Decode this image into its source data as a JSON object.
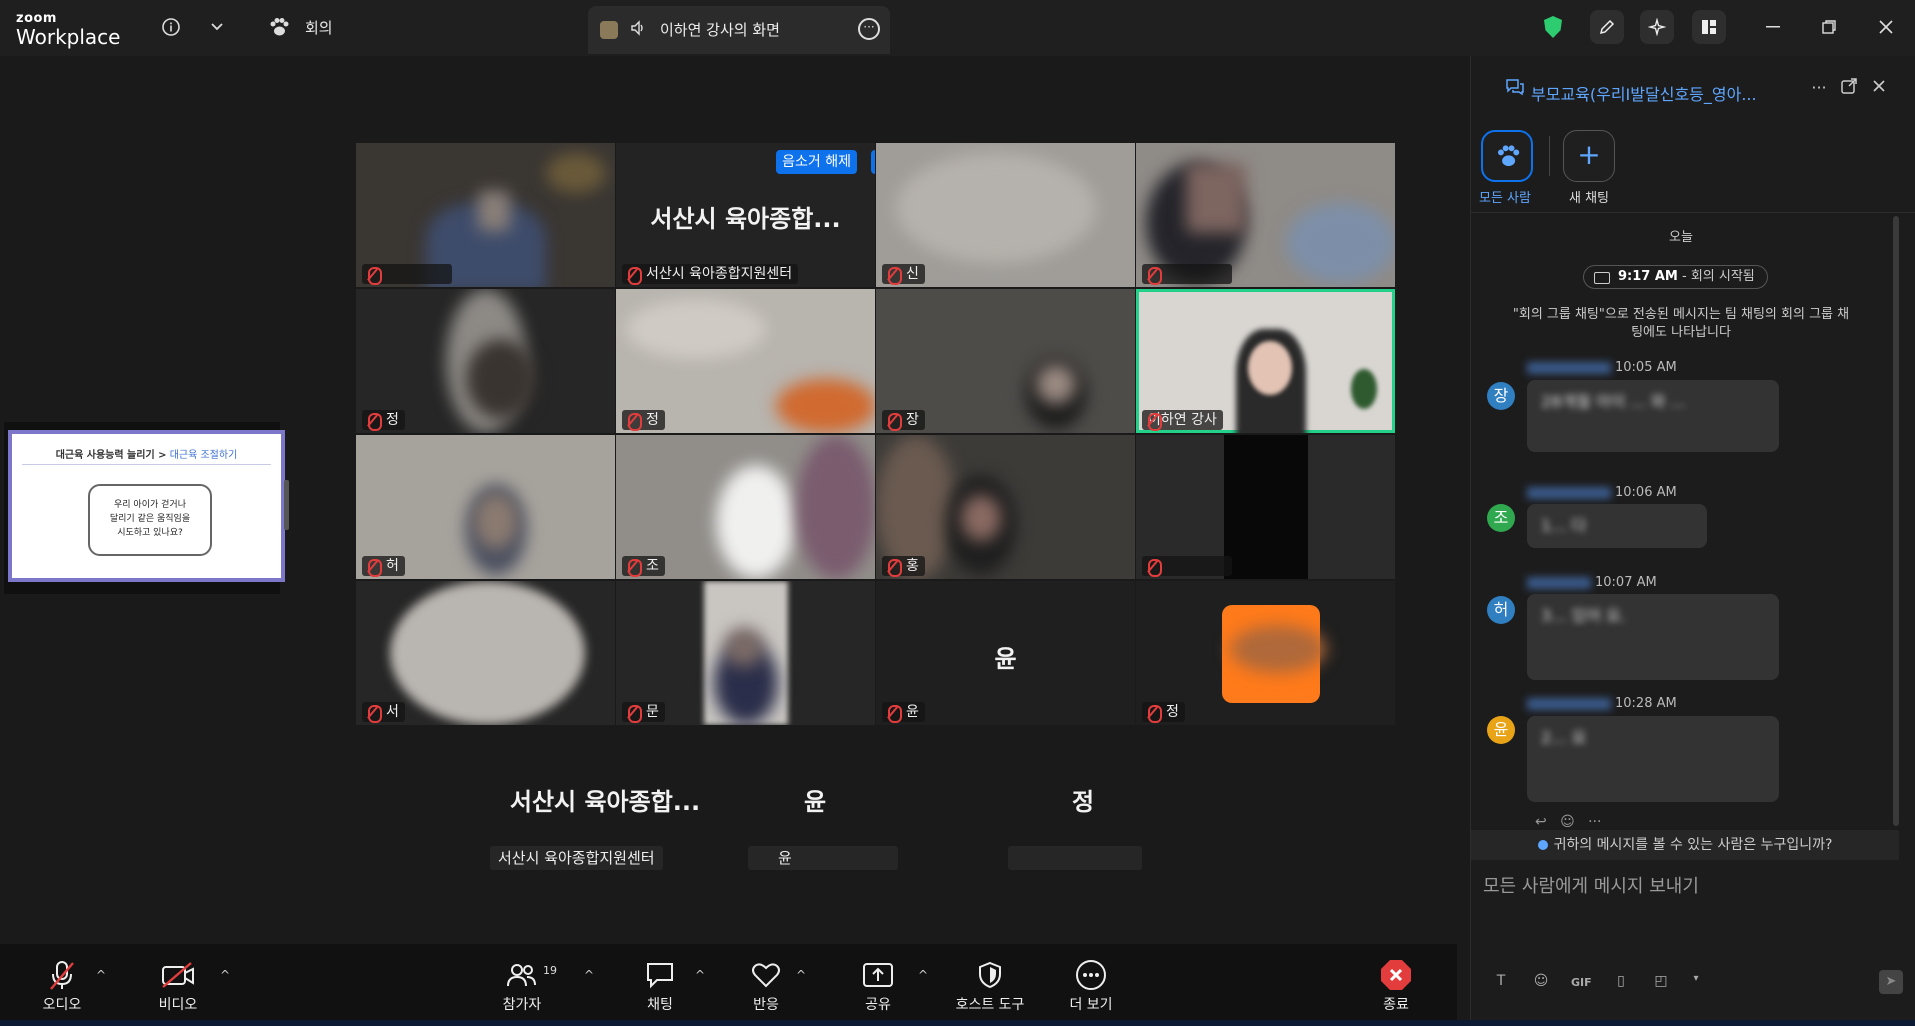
{
  "app": {
    "logo_top": "zoom",
    "logo_bottom": "Workplace",
    "meeting_menu_label": "회의",
    "share_title": "이하연 강사의 화면"
  },
  "grid": {
    "unmute_label": "음소거 해제",
    "tiles": [
      {
        "name": "",
        "big": ""
      },
      {
        "name": "서산시 육아종합지원센터",
        "big": "서산시 육아종합..."
      },
      {
        "name": "신",
        "big": ""
      },
      {
        "name": "",
        "big": ""
      },
      {
        "name": "정",
        "big": ""
      },
      {
        "name": "정",
        "big": ""
      },
      {
        "name": "장",
        "big": ""
      },
      {
        "name": "이하연 강사",
        "big": ""
      },
      {
        "name": "허",
        "big": ""
      },
      {
        "name": "조",
        "big": ""
      },
      {
        "name": "홍",
        "big": ""
      },
      {
        "name": "",
        "big": ""
      },
      {
        "name": "서",
        "big": ""
      },
      {
        "name": "문",
        "big": ""
      },
      {
        "name": "윤",
        "big": "윤"
      },
      {
        "name": "정",
        "big": ""
      }
    ],
    "bottom_row": [
      {
        "big": "서산시 육아종합...",
        "label": "서산시 육아종합지원센터"
      },
      {
        "big": "윤",
        "label": "윤"
      },
      {
        "big": "정",
        "label": ""
      }
    ]
  },
  "slide": {
    "header_left": "대근육 사용능력 늘리기 >",
    "header_right": "대근육 조절하기",
    "bubble_line1": "우리 아이가 걷거나",
    "bubble_line2": "달리기 같은 움직임을",
    "bubble_line3": "시도하고 있나요?"
  },
  "chat": {
    "title": "부모교육(우리I발달신호등_영아...",
    "everyone_label": "모든 사람",
    "new_chat_label": "새 채팅",
    "today_label": "오늘",
    "meeting_start_time": "9:17 AM",
    "meeting_start_text": "- 회의 시작됨",
    "notice": "\"회의 그룹 채팅\"으로 전송된 메시지는 팀 채팅의 회의 그룹 채팅에도 나타납니다",
    "messages": [
      {
        "avatar": "장",
        "color": "#2f7fc1",
        "time": "10:05 AM",
        "text": "28개월 아이 ... 와 ..."
      },
      {
        "avatar": "조",
        "color": "#2fa84f",
        "time": "10:06 AM",
        "text": "1... 다"
      },
      {
        "avatar": "허",
        "color": "#2f7fc1",
        "time": "10:07 AM",
        "text": "3... 있어 요."
      },
      {
        "avatar": "윤",
        "color": "#e8a317",
        "time": "10:28 AM",
        "text": "2... 요"
      }
    ],
    "who_can_see": "귀하의 메시지를 볼 수 있는 사람은 누구입니까?",
    "compose_placeholder": "모든 사람에게 메시지 보내기",
    "gif_label": "GIF"
  },
  "toolbar": {
    "audio": "오디오",
    "video": "비디오",
    "participants": "참가자",
    "participants_count": "19",
    "chat": "채팅",
    "reactions": "반응",
    "share": "공유",
    "host_tools": "호스트 도구",
    "more": "더 보기",
    "end": "종료"
  },
  "colors": {
    "accent": "#0e72ed",
    "active_speaker": "#23d18b",
    "end_red": "#e23c3c",
    "security_green": "#2ecc71"
  }
}
